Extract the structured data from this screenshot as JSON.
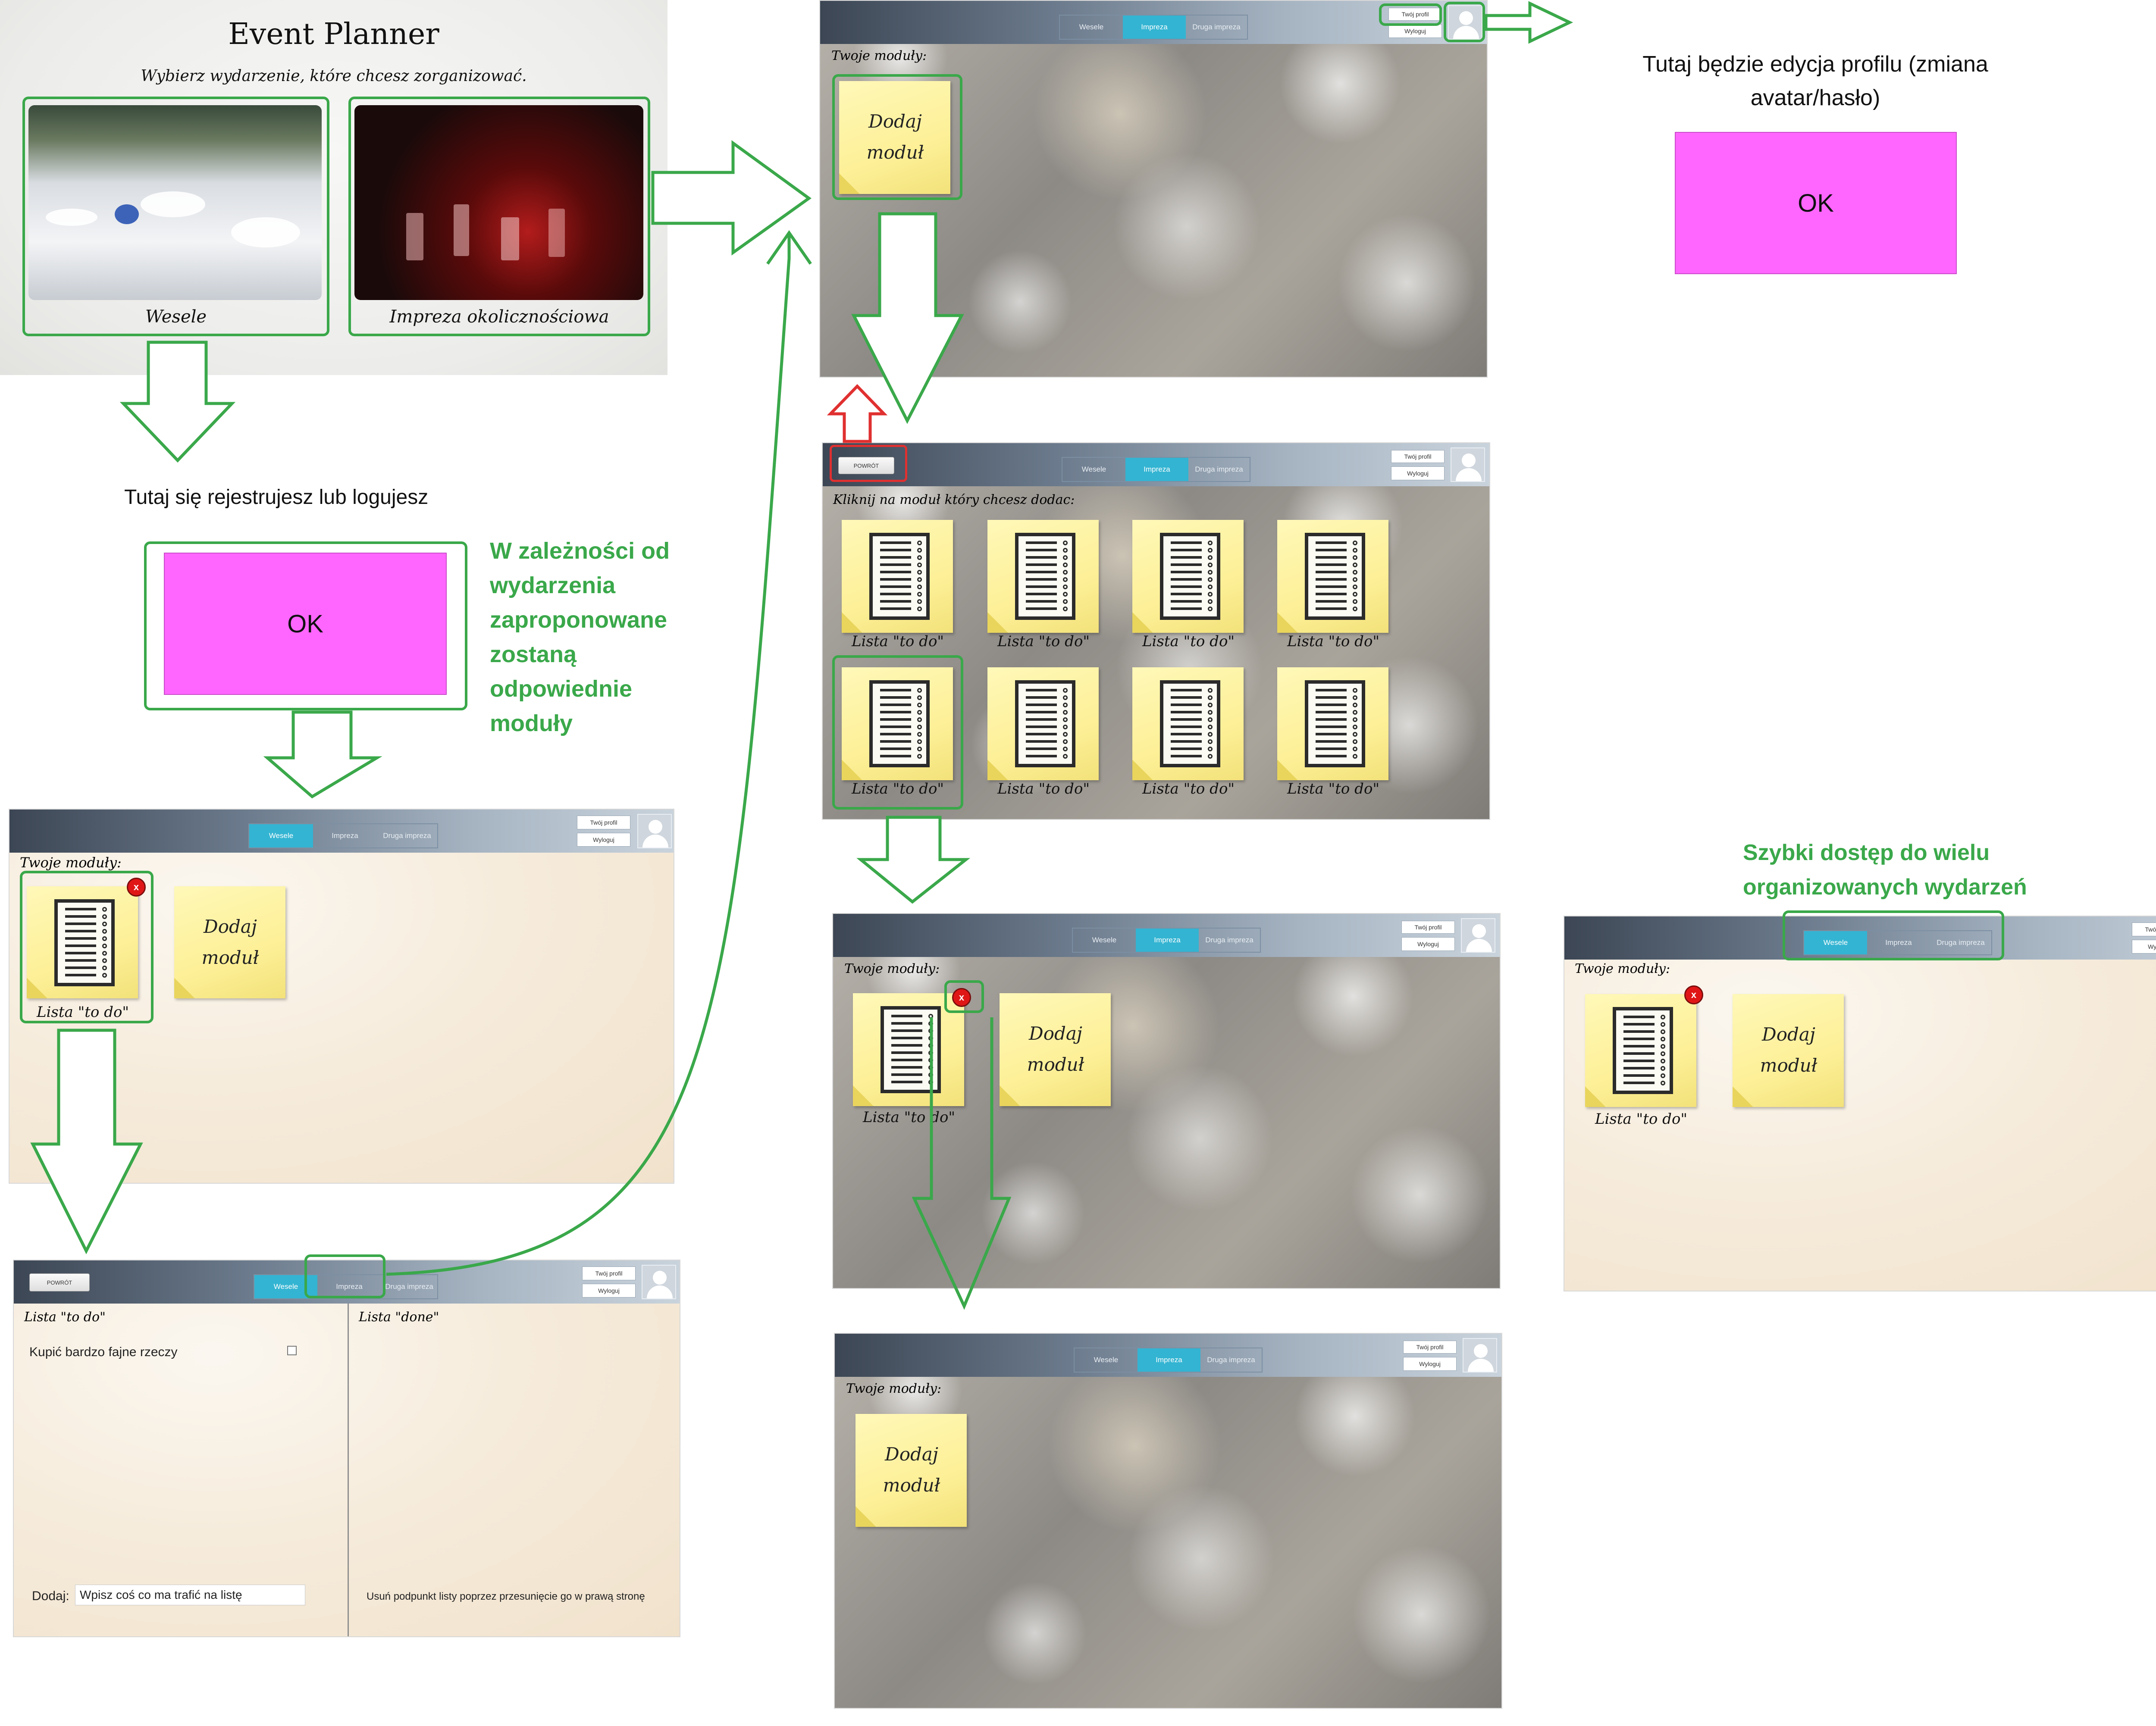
{
  "colors": {
    "accent_tab": "#33b4d2",
    "flow_green": "#3aa84a",
    "placeholder_pink": "#ff66ff",
    "delete_red": "#e01616",
    "note_yellow": "#fdf098",
    "back_highlight_red": "#e03030"
  },
  "start": {
    "title": "Event Planner",
    "subtitle": "Wybierz wydarzenie, które chcesz zorganizować.",
    "options": [
      {
        "label": "Wesele"
      },
      {
        "label": "Impreza okolicznościowa"
      }
    ]
  },
  "auth": {
    "text": "Tutaj się rejestrujesz lub logujesz",
    "button": "OK",
    "note": "W zależności od wydarzenia zaproponowane zostaną odpowiednie moduły"
  },
  "profile": {
    "text": "Tutaj będzie edycja profilu (zmiana avatar/hasło)",
    "button": "OK"
  },
  "quick_access": {
    "note": "Szybki dostęp do wielu organizowanych wydarzeń"
  },
  "nav": {
    "tabs": [
      "Wesele",
      "Impreza",
      "Druga impreza"
    ],
    "profile_label": "Twój profil",
    "logout_label": "Wyloguj",
    "back_label": "POWRÓT"
  },
  "modules": {
    "header": "Twoje moduły:",
    "add_module": "Dodaj moduł",
    "todo_label": "Lista \"to do\"",
    "delete_symbol": "x"
  },
  "picker": {
    "header": "Kliknij na moduł który chcesz dodac:",
    "items": [
      "Lista \"to do\"",
      "Lista \"to do\"",
      "Lista \"to do\"",
      "Lista \"to do\"",
      "Lista \"to do\"",
      "Lista \"to do\"",
      "Lista \"to do\"",
      "Lista \"to do\""
    ]
  },
  "todo_screen": {
    "todo_header": "Lista \"to do\"",
    "done_header": "Lista \"done\"",
    "item": "Kupić bardzo fajne rzeczy",
    "add_label": "Dodaj:",
    "add_placeholder": "Wpisz coś co ma trafić na listę",
    "hint": "Usuń podpunkt listy poprzez przesunięcie go w prawą stronę"
  }
}
